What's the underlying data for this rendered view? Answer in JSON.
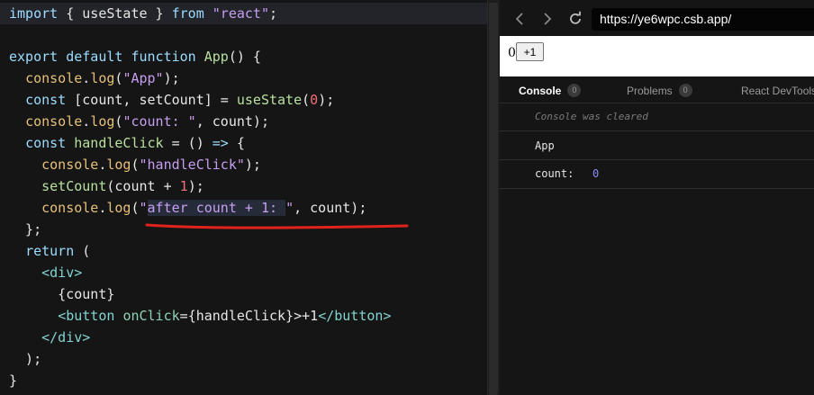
{
  "editor": {
    "lines": [
      [
        {
          "t": "import",
          "c": "kw"
        },
        {
          "t": " { ",
          "c": "plain"
        },
        {
          "t": "useState",
          "c": "plain"
        },
        {
          "t": " } ",
          "c": "plain"
        },
        {
          "t": "from",
          "c": "kw"
        },
        {
          "t": " ",
          "c": "plain"
        },
        {
          "t": "\"react\"",
          "c": "str"
        },
        {
          "t": ";",
          "c": "plain"
        }
      ],
      [],
      [
        {
          "t": "export",
          "c": "kw"
        },
        {
          "t": " ",
          "c": "plain"
        },
        {
          "t": "default",
          "c": "kw"
        },
        {
          "t": " ",
          "c": "plain"
        },
        {
          "t": "function",
          "c": "kw"
        },
        {
          "t": " ",
          "c": "plain"
        },
        {
          "t": "App",
          "c": "fn"
        },
        {
          "t": "() {",
          "c": "plain"
        }
      ],
      [
        {
          "t": "  ",
          "c": "plain"
        },
        {
          "t": "console",
          "c": "cfn"
        },
        {
          "t": ".",
          "c": "plain"
        },
        {
          "t": "log",
          "c": "cfn"
        },
        {
          "t": "(",
          "c": "plain"
        },
        {
          "t": "\"App\"",
          "c": "str"
        },
        {
          "t": ");",
          "c": "plain"
        }
      ],
      [
        {
          "t": "  ",
          "c": "plain"
        },
        {
          "t": "const",
          "c": "kw"
        },
        {
          "t": " [count, setCount] = ",
          "c": "plain"
        },
        {
          "t": "useState",
          "c": "fn"
        },
        {
          "t": "(",
          "c": "plain"
        },
        {
          "t": "0",
          "c": "num"
        },
        {
          "t": ");",
          "c": "plain"
        }
      ],
      [
        {
          "t": "  ",
          "c": "plain"
        },
        {
          "t": "console",
          "c": "cfn"
        },
        {
          "t": ".",
          "c": "plain"
        },
        {
          "t": "log",
          "c": "cfn"
        },
        {
          "t": "(",
          "c": "plain"
        },
        {
          "t": "\"count: \"",
          "c": "str"
        },
        {
          "t": ", count);",
          "c": "plain"
        }
      ],
      [
        {
          "t": "  ",
          "c": "plain"
        },
        {
          "t": "const",
          "c": "kw"
        },
        {
          "t": " ",
          "c": "plain"
        },
        {
          "t": "handleClick",
          "c": "fn"
        },
        {
          "t": " = () ",
          "c": "plain"
        },
        {
          "t": "=>",
          "c": "kw"
        },
        {
          "t": " {",
          "c": "plain"
        }
      ],
      [
        {
          "t": "    ",
          "c": "plain"
        },
        {
          "t": "console",
          "c": "cfn"
        },
        {
          "t": ".",
          "c": "plain"
        },
        {
          "t": "log",
          "c": "cfn"
        },
        {
          "t": "(",
          "c": "plain"
        },
        {
          "t": "\"handleClick\"",
          "c": "str"
        },
        {
          "t": ");",
          "c": "plain"
        }
      ],
      [
        {
          "t": "    ",
          "c": "plain"
        },
        {
          "t": "setCount",
          "c": "fn"
        },
        {
          "t": "(count + ",
          "c": "plain"
        },
        {
          "t": "1",
          "c": "num"
        },
        {
          "t": ");",
          "c": "plain"
        }
      ],
      [
        {
          "t": "    ",
          "c": "plain"
        },
        {
          "t": "console",
          "c": "cfn"
        },
        {
          "t": ".",
          "c": "plain"
        },
        {
          "t": "log",
          "c": "cfn"
        },
        {
          "t": "(",
          "c": "plain"
        },
        {
          "t": "\"",
          "c": "str"
        },
        {
          "t": "after count + 1: ",
          "c": "str",
          "box": true
        },
        {
          "t": "\"",
          "c": "str"
        },
        {
          "t": ", count);",
          "c": "plain"
        }
      ],
      [
        {
          "t": "  };",
          "c": "plain"
        }
      ],
      [
        {
          "t": "  ",
          "c": "plain"
        },
        {
          "t": "return",
          "c": "kw"
        },
        {
          "t": " (",
          "c": "plain"
        }
      ],
      [
        {
          "t": "    ",
          "c": "plain"
        },
        {
          "t": "<div>",
          "c": "jsx"
        }
      ],
      [
        {
          "t": "      {count}",
          "c": "plain"
        }
      ],
      [
        {
          "t": "      ",
          "c": "plain"
        },
        {
          "t": "<button",
          "c": "jsx"
        },
        {
          "t": " ",
          "c": "plain"
        },
        {
          "t": "onClick",
          "c": "attr"
        },
        {
          "t": "=",
          "c": "plain"
        },
        {
          "t": "{handleClick}",
          "c": "plain"
        },
        {
          "t": ">+1",
          "c": "plain"
        },
        {
          "t": "</button>",
          "c": "jsx"
        }
      ],
      [
        {
          "t": "    ",
          "c": "plain"
        },
        {
          "t": "</div>",
          "c": "jsx"
        }
      ],
      [
        {
          "t": "  );",
          "c": "plain"
        }
      ],
      [
        {
          "t": "}",
          "c": "plain"
        }
      ]
    ],
    "colors": {
      "kw": "#9cdcfe",
      "fn": "#b8e0a0",
      "cfn": "#e6c07b",
      "str": "#c69ff0",
      "num": "#f07178",
      "jsx": "#82d4d0",
      "attr": "#8fd3b6",
      "plain": "#e6e6e6"
    },
    "annotation_color": "#e0231c"
  },
  "browser": {
    "back_icon": "chevron-left-icon",
    "forward_icon": "chevron-right-icon",
    "reload_icon": "reload-icon",
    "url": "https://ye6wpc.csb.app/",
    "preview": {
      "count": "0",
      "button_label": "+1"
    },
    "devtools": {
      "tabs": [
        {
          "label": "Console",
          "badge": "0",
          "active": true
        },
        {
          "label": "Problems",
          "badge": "0",
          "active": false
        },
        {
          "label": "React DevTools",
          "badge": "",
          "active": false
        }
      ],
      "console": {
        "cleared_text": "Console was cleared",
        "entries": [
          {
            "text": "App",
            "value": ""
          },
          {
            "text": "count: ",
            "value": "0"
          }
        ],
        "value_color": "#8f8cf4"
      }
    }
  }
}
